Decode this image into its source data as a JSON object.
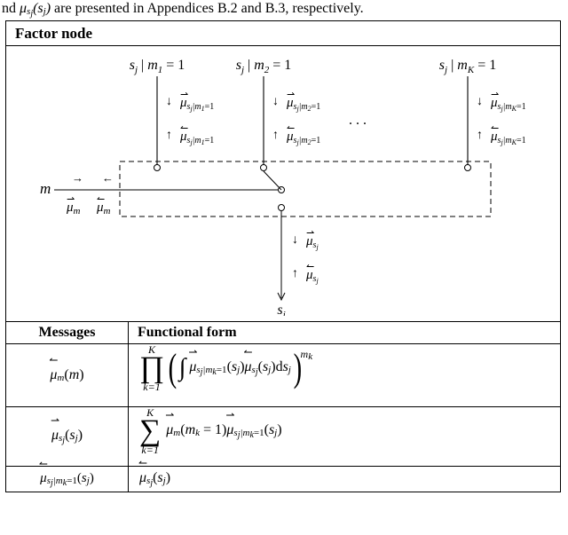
{
  "top_text": "nd μ̆ₛⱼ(sⱼ) are presented in Appendices B.2 and B.3, respectively.",
  "factor_node": {
    "title": "Factor node",
    "top_labels": {
      "c1": "s_j | m_1 = 1",
      "c2": "s_j | m_2 = 1",
      "ellipsis": ". . .",
      "cK": "s_j | m_K = 1"
    },
    "edge_msgs": {
      "c1_fwd": "μ⃗_{s_j|m_1=1}",
      "c1_bwd": "μ̆_{s_j|m_1=1}",
      "c2_fwd": "μ⃗_{s_j|m_2=1}",
      "c2_bwd": "μ̆_{s_j|m_2=1}",
      "cK_fwd": "μ⃗_{s_j|m_K=1}",
      "cK_bwd": "μ̆_{s_j|m_K=1}",
      "m_left": "m",
      "m_fwd": "μ⃗_m",
      "m_bwd": "μ̆_m",
      "sj_out_fwd": "μ⃗_{s_j}",
      "sj_out_bwd": "μ̆_{s_j}",
      "sj": "s_j"
    }
  },
  "messages": {
    "header_left": "Messages",
    "header_right": "Functional form",
    "rows": {
      "r1_left": "μ̆_m(m)",
      "r1_right": "∏_{k=1}^{K} ( ∫ μ⃗_{s_j|m_k=1}(s_j) μ̆_{s_j}(s_j) d s_j )^{m_k}",
      "r2_left": "μ⃗_{s_j}(s_j)",
      "r2_right": "∑_{k=1}^{K} μ⃗_m(m_k = 1) μ⃗_{s_j|m_k=1}(s_j)",
      "r3_left": "μ̆_{s_j|m_k=1}(s_j)",
      "r3_right": "μ̆_{s_j}(s_j)"
    }
  }
}
